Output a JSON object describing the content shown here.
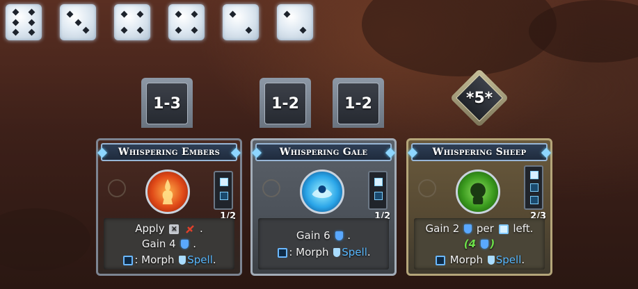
{
  "dice_tray": [
    {
      "face": 6
    },
    {
      "face": 3
    },
    {
      "face": 4
    },
    {
      "face": 4
    },
    {
      "face": 2
    },
    {
      "face": 2
    }
  ],
  "cards": [
    {
      "id": "embers",
      "title": "Whispering Embers",
      "range_tags": [
        "1-3"
      ],
      "portrait_icon": "fire-spirit-icon",
      "slot_count": "1/2",
      "lines": {
        "l1_pre": "Apply",
        "l1_post": ".",
        "l2_pre": "Gain 4",
        "l2_post": ".",
        "l3_pre": ": Morph",
        "l3_spell": "Spell",
        "l3_post": "."
      }
    },
    {
      "id": "gale",
      "title": "Whispering Gale",
      "range_tags": [
        "1-2",
        "1-2"
      ],
      "portrait_icon": "wind-spirit-icon",
      "slot_count": "1/2",
      "lines": {
        "l1_pre": "Gain 6",
        "l1_post": ".",
        "l2_pre": ": Morph",
        "l2_spell": "Spell",
        "l2_post": "."
      }
    },
    {
      "id": "sheep",
      "title": "Whispering Sheep",
      "range_tags": [
        "*5*"
      ],
      "portrait_icon": "sheep-spirit-icon",
      "slot_count": "2/3",
      "lines": {
        "l1_pre": "Gain 2",
        "l1_mid": "per",
        "l1_post": "left.",
        "l2_open": "(",
        "l2_num": "4",
        "l2_close": ")",
        "l3_pre": "Morph",
        "l3_spell": "Spell",
        "l3_post": "."
      }
    }
  ],
  "colors": {
    "shield": "#5aa8ff",
    "spell_text": "#58b8ff",
    "green_value": "#6ee04a"
  }
}
